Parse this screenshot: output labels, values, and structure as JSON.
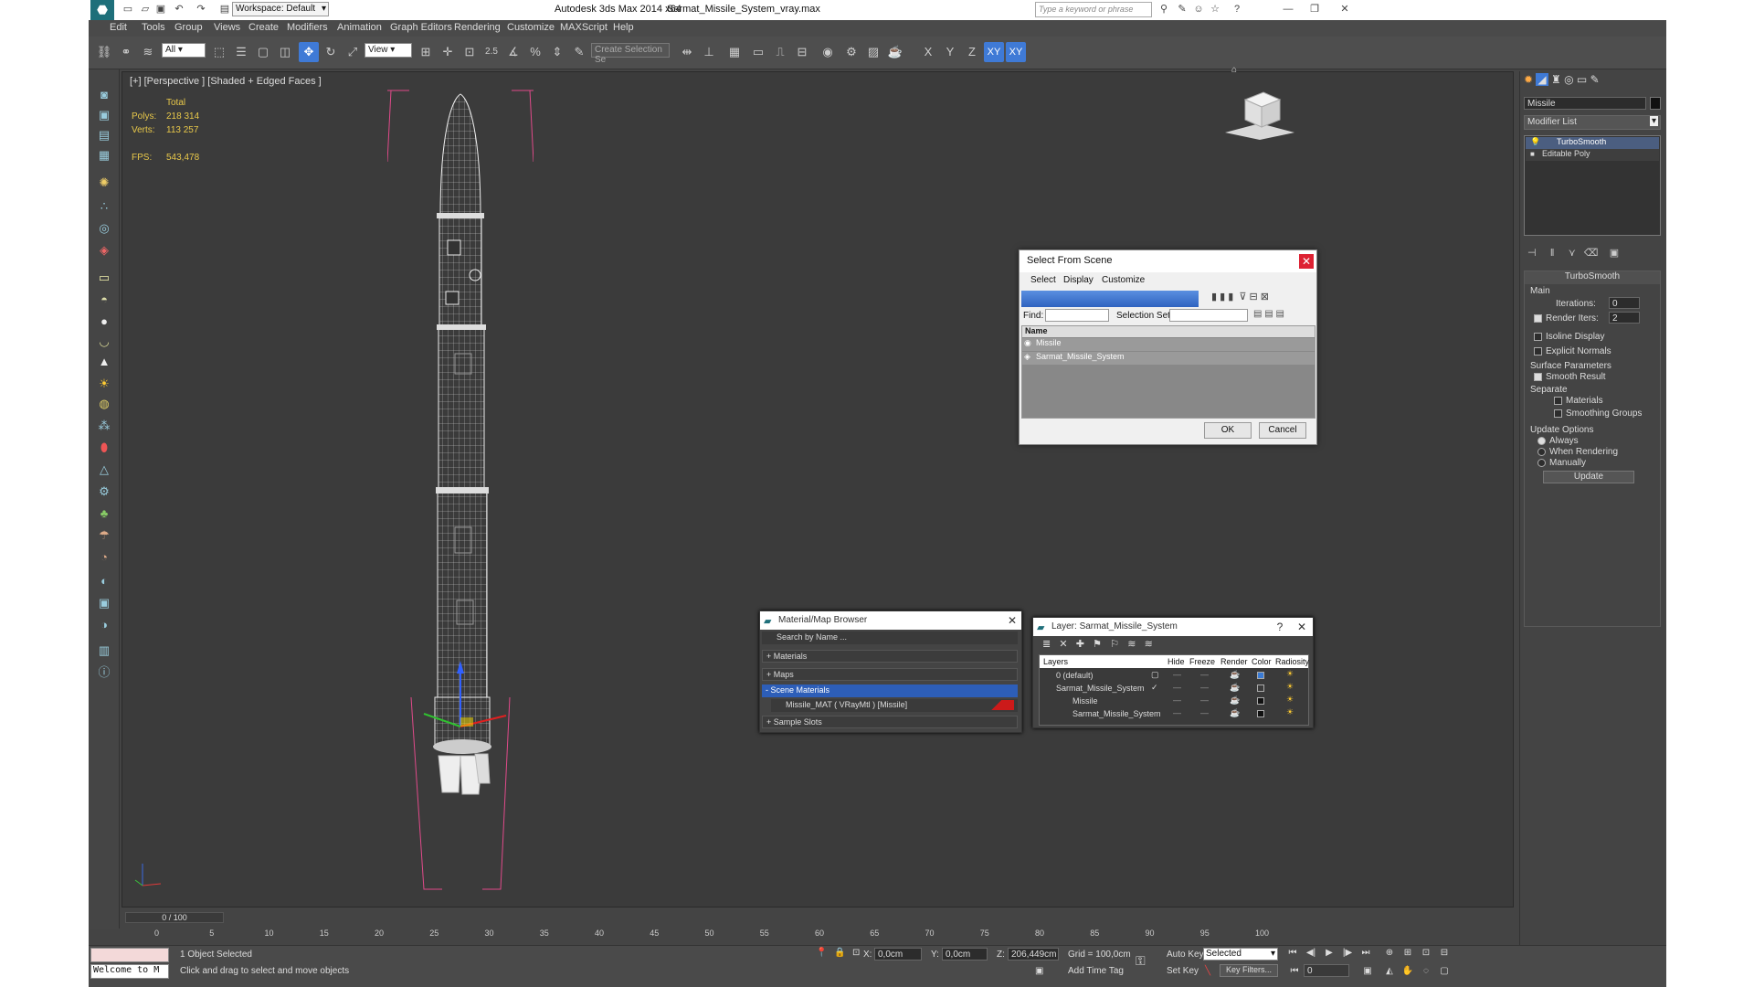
{
  "app": {
    "title": "Autodesk 3ds Max  2014 x64",
    "file": "Sarmat_Missile_System_vray.max",
    "workspace": "Workspace: Default",
    "search_placeholder": "Type a keyword or phrase"
  },
  "menu": [
    "Edit",
    "Tools",
    "Group",
    "Views",
    "Create",
    "Modifiers",
    "Animation",
    "Graph Editors",
    "Rendering",
    "Customize",
    "MAXScript",
    "Help"
  ],
  "toolbar": {
    "filter": "All",
    "refcoord": "View",
    "snap_angle": "2.5",
    "selection_set": "Create Selection Se",
    "axes": [
      "X",
      "Y",
      "Z",
      "XY",
      "XY"
    ]
  },
  "viewport": {
    "label": "[+] [Perspective ] [Shaded + Edged Faces ]",
    "stats_total": "Total",
    "polys_label": "Polys:",
    "polys_value": "218 314",
    "verts_label": "Verts:",
    "verts_value": "113 257",
    "fps_label": "FPS:",
    "fps_value": "543,478"
  },
  "command_panel": {
    "object_name": "Missile",
    "modifier_list": "Modifier List",
    "stack": [
      "TurboSmooth",
      "Editable Poly"
    ],
    "rollout_title": "TurboSmooth",
    "main_label": "Main",
    "iterations_label": "Iterations:",
    "iterations_value": "0",
    "render_iters_label": "Render Iters:",
    "render_iters_value": "2",
    "isoline": "Isoline Display",
    "explicit_normals": "Explicit Normals",
    "surface_params": "Surface Parameters",
    "smooth_result": "Smooth Result",
    "separate": "Separate",
    "materials": "Materials",
    "smoothing_groups": "Smoothing Groups",
    "update_options": "Update Options",
    "always": "Always",
    "when_rendering": "When Rendering",
    "manually": "Manually",
    "update_btn": "Update"
  },
  "select_dialog": {
    "title": "Select From Scene",
    "menu": [
      "Select",
      "Display",
      "Customize"
    ],
    "find_label": "Find:",
    "selection_set_label": "Selection Set:",
    "col_name": "Name",
    "items": [
      "Missile",
      "Sarmat_Missile_System"
    ],
    "ok": "OK",
    "cancel": "Cancel"
  },
  "material_browser": {
    "title": "Material/Map Browser",
    "search": "Search by Name ...",
    "sections": [
      "+ Materials",
      "+ Maps",
      "- Scene Materials",
      "+ Sample Slots"
    ],
    "material": "Missile_MAT ( VRayMtl ) [Missile]",
    "swatch_color": "#cc1a1a"
  },
  "layer_dialog": {
    "title": "Layer: Sarmat_Missile_System",
    "help": "?",
    "columns": [
      "Layers",
      "Hide",
      "Freeze",
      "Render",
      "Color",
      "Radiosity"
    ],
    "rows": [
      {
        "name": "0 (default)",
        "color": "#3a7bd5"
      },
      {
        "name": "Sarmat_Missile_System",
        "color": "#3a3a3a"
      },
      {
        "name": "Missile",
        "color": "#111111"
      },
      {
        "name": "Sarmat_Missile_System",
        "color": "#111111"
      }
    ]
  },
  "timeline": {
    "frame": "0 / 100",
    "ticks": [
      "0",
      "5",
      "10",
      "15",
      "20",
      "25",
      "30",
      "35",
      "40",
      "45",
      "50",
      "55",
      "60",
      "65",
      "70",
      "75",
      "80",
      "85",
      "90",
      "95",
      "100"
    ]
  },
  "status": {
    "maxscript": "Welcome to M",
    "selected": "1 Object Selected",
    "prompt": "Click and drag to select and move objects",
    "x_label": "X:",
    "x_value": "0,0cm",
    "y_label": "Y:",
    "y_value": "0,0cm",
    "z_label": "Z:",
    "z_value": "206,449cm",
    "grid": "Grid = 100,0cm",
    "add_time_tag": "Add Time Tag",
    "auto_key": "Auto Key",
    "set_key": "Set Key",
    "key_mode": "Selected",
    "key_filters": "Key Filters...",
    "frame_field": "0"
  }
}
